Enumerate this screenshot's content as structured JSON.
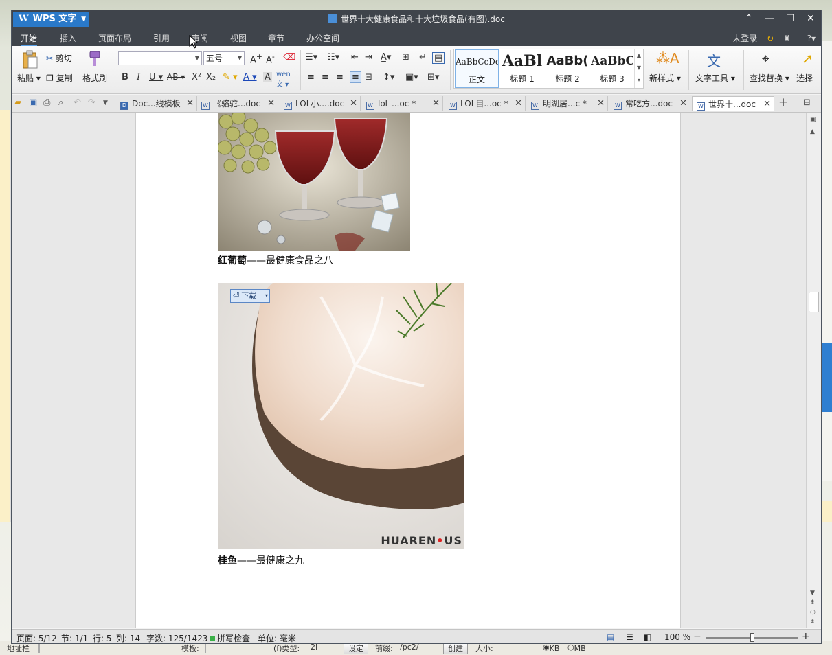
{
  "app": {
    "name": "WPS 文字",
    "doc_title": "世界十大健康食品和十大垃圾食品(有图).doc"
  },
  "menu": {
    "items": [
      "开始",
      "插入",
      "页面布局",
      "引用",
      "审阅",
      "视图",
      "章节",
      "办公空间"
    ],
    "login": "未登录",
    "help": "?"
  },
  "ribbon": {
    "paste": "粘贴",
    "cut": "剪切",
    "copy": "复制",
    "format_painter": "格式刷",
    "font_name": "",
    "font_size": "五号",
    "styles": [
      {
        "preview": "AaBbCcDc",
        "label": "正文"
      },
      {
        "preview": "AaBl",
        "label": "标题 1"
      },
      {
        "preview": "AaBb(",
        "label": "标题 2"
      },
      {
        "preview": "AaBbC",
        "label": "标题 3"
      }
    ],
    "new_style": "新样式",
    "text_tools": "文字工具",
    "find_replace": "查找替换",
    "select": "选择"
  },
  "tabs": [
    {
      "label": "Doc...线模板"
    },
    {
      "label": "《骆驼...doc"
    },
    {
      "label": "LOL小....doc"
    },
    {
      "label": "lol_...oc *"
    },
    {
      "label": "LOL目...oc *"
    },
    {
      "label": "明湖居...c *"
    },
    {
      "label": "常吃方...doc"
    },
    {
      "label": "世界十...doc"
    }
  ],
  "document": {
    "caption1_bold": "红葡萄",
    "caption1_rest": "——最健康食品之八",
    "download_button": "下载",
    "watermark": "HUAREN.US",
    "caption2_bold": "桂鱼",
    "caption2_rest": "——最健康之九"
  },
  "status": {
    "page": "页面: 5/12",
    "section": "节: 1/1",
    "row": "行: 5",
    "col": "列: 14",
    "words": "字数: 125/1423",
    "spell": "拼写检查",
    "unit": "单位: 毫米",
    "zoom": "100 %"
  },
  "desktop_bottom": {
    "address": "地址栏",
    "mode": "模板:",
    "type_label": "(f)类型:",
    "type_val": "2I",
    "set": "设定",
    "prefix": "前缀:",
    "prefix_val": "/pc2/",
    "create": "创建",
    "size": "大小:",
    "kb": "KB",
    "mb": "MB"
  }
}
